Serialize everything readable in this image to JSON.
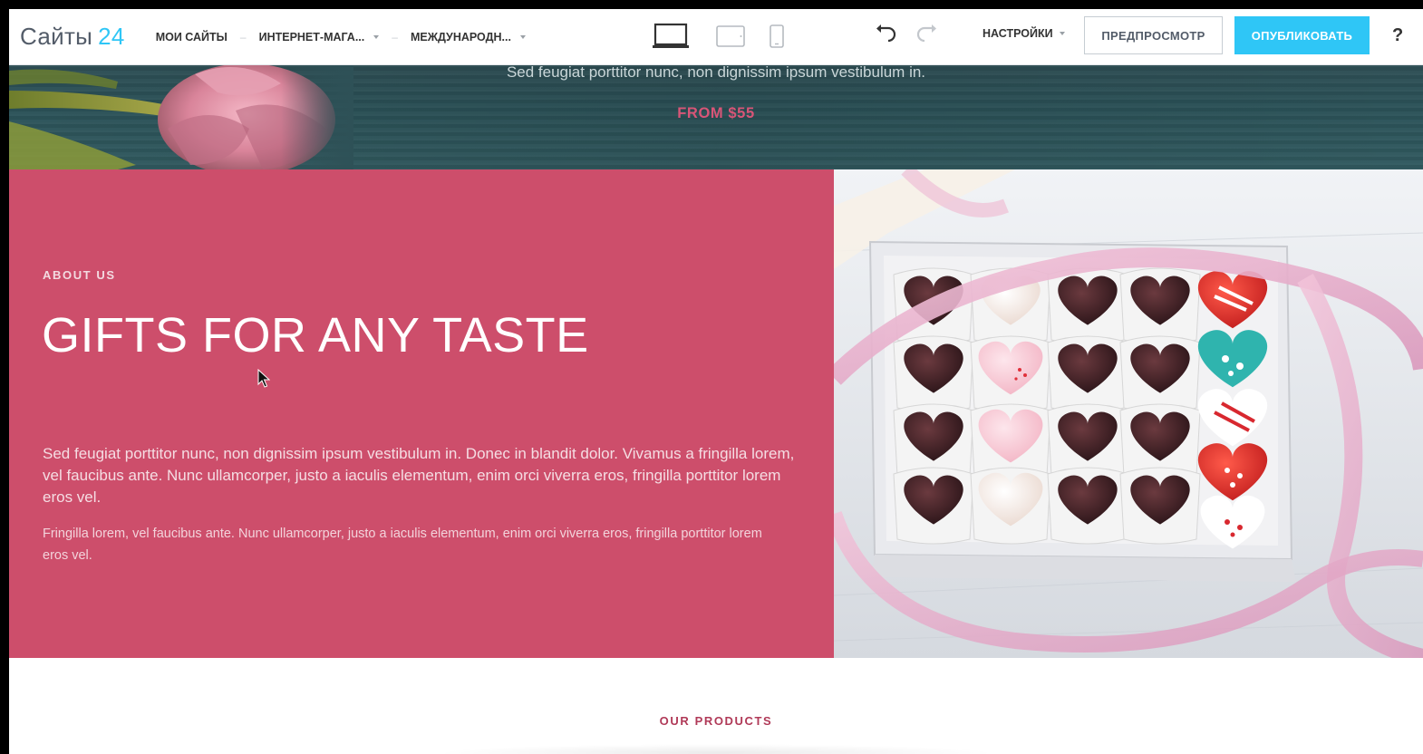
{
  "topbar": {
    "logo_text": "Сайты",
    "logo_num": "24",
    "nav": [
      {
        "label": "МОИ САЙТЫ"
      },
      {
        "label": "ИНТЕРНЕТ-МАГА..."
      },
      {
        "label": "МЕЖДУНАРОДН..."
      }
    ],
    "settings_label": "НАСТРОЙКИ",
    "preview_label": "ПРЕДПРОСМОТР",
    "publish_label": "ОПУБЛИКОВАТЬ",
    "help_label": "?"
  },
  "hero": {
    "text": "Sed feugiat porttitor nunc, non dignissim ipsum vestibulum in.",
    "price": "FROM $55"
  },
  "about": {
    "label": "ABOUT US",
    "title": "GIFTS FOR ANY TASTE",
    "p1": "Sed feugiat porttitor nunc, non dignissim ipsum vestibulum in. Donec in blandit dolor. Vivamus a fringilla lorem, vel faucibus ante. Nunc ullamcorper, justo a iaculis elementum, enim orci viverra eros, fringilla porttitor lorem eros vel.",
    "p2": "Fringilla lorem, vel faucibus ante. Nunc ullamcorper, justo a iaculis elementum, enim orci viverra eros, fringilla porttitor lorem eros vel."
  },
  "products": {
    "label": "OUR PRODUCTS"
  },
  "colors": {
    "accent": "#2fc6f6",
    "about_bg": "#cd4e6b",
    "price": "#d85577"
  }
}
